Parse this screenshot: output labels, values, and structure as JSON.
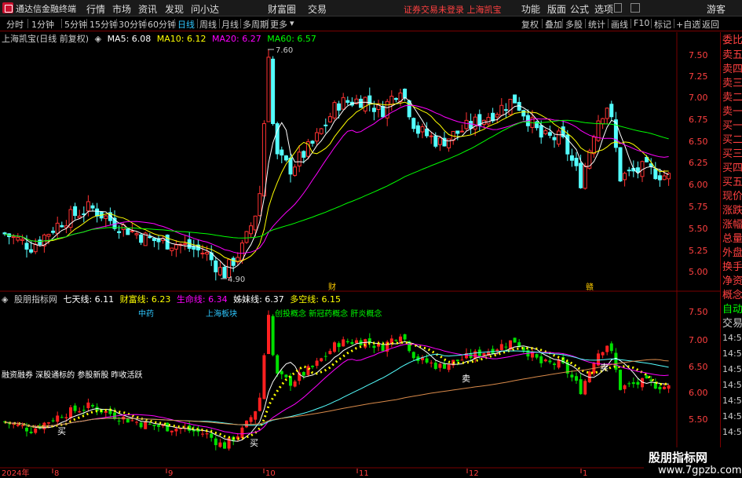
{
  "titlebar": {
    "app_title": "通达信金融终端",
    "menus": [
      "行情",
      "市场",
      "资讯",
      "发现",
      "问小达",
      "财富圈",
      "交易"
    ],
    "login_tip": "证券交易未登录  上海凯宝",
    "right_menus": [
      "功能",
      "版面",
      "公式",
      "选项"
    ],
    "guest": "游客"
  },
  "toolbar": {
    "periods": [
      "分时",
      "1分钟",
      "5分钟",
      "15分钟",
      "30分钟",
      "60分钟",
      "日线",
      "周线",
      "月线",
      "多周期",
      "更多"
    ],
    "active_period": "日线",
    "right_items": [
      "复权",
      "叠加",
      "多股",
      "统计",
      "画线",
      "F10",
      "标记",
      "+自选",
      "返回"
    ]
  },
  "main_legend": {
    "stock": "上海凯宝(日线 前复权)",
    "ma5": "MA5: 6.08",
    "ma10": "MA10: 6.12",
    "ma20": "MA20: 6.27",
    "ma60": "MA60: 6.57",
    "colors": {
      "ma5": "#ffffff",
      "ma10": "#ffff00",
      "ma20": "#ff00ff",
      "ma60": "#00ff00"
    }
  },
  "main_axis": {
    "ticks": [
      "7.50",
      "7.25",
      "7.00",
      "6.75",
      "6.50",
      "6.25",
      "6.00",
      "5.75",
      "5.50",
      "5.25",
      "5.00"
    ],
    "high_label": "7.60",
    "low_label": "4.90",
    "events": [
      "财",
      "赣"
    ]
  },
  "sub_legend": {
    "name": "股朋指标网",
    "qitian": "七天线: 6.11",
    "caifu": "财富线: 6.23",
    "shengming": "生命线: 6.34",
    "zimei": "姊妹线: 6.37",
    "duokong": "多空线: 6.15",
    "colors": {
      "qitian": "#ffffff",
      "caifu": "#ffff00",
      "shengming": "#ff00ff",
      "zimei": "#ffffff",
      "duokong": "#ffff00"
    }
  },
  "sub_concepts": {
    "tag1": "中药",
    "tag2": "上海板块",
    "tag3": "创投概念  新冠药概念  肝炎概念",
    "info": "融资融券  深股通标的  参股新股  昨收活跃",
    "buy_label": "买",
    "sell_label": "卖"
  },
  "sub_axis": {
    "ticks": [
      "7.50",
      "7.00",
      "6.50",
      "6.00",
      "5.50"
    ]
  },
  "date_axis": {
    "labels": [
      "2024年",
      "8",
      "9",
      "10",
      "11",
      "12",
      "1"
    ]
  },
  "side_panel": {
    "items": [
      "委比",
      "卖五",
      "卖四",
      "卖三",
      "卖二",
      "卖一",
      "买一",
      "买二",
      "买三",
      "买四",
      "买五",
      "现价",
      "涨跌",
      "涨幅",
      "总量",
      "外盘",
      "换手",
      "净资",
      "概念",
      "自动",
      "交易",
      "14:56",
      "14:56",
      "14:56",
      "14:56",
      "14:56",
      "14:56",
      "14:56"
    ]
  },
  "watermark": {
    "line1": "股朋指标网",
    "line2": "www.7gpzb.com"
  }
}
